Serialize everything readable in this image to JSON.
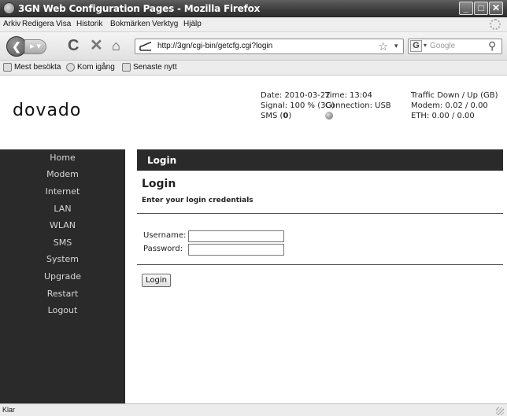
{
  "window": {
    "title": "3GN Web Configuration Pages - Mozilla Firefox",
    "min_glyph": "_",
    "max_glyph": "□",
    "close_glyph": "✕"
  },
  "menubar": {
    "items": [
      "Arkiv",
      "Redigera",
      "Visa",
      "Historik",
      "Bokmärken",
      "Verktyg",
      "Hjälp"
    ]
  },
  "toolbar": {
    "back_glyph": "❮",
    "forward_glyph": "▸ ▾",
    "reload_glyph": "C",
    "stop_glyph": "✕",
    "home_glyph": "⌂",
    "url": "http://3gn/cgi-bin/getcfg.cgi?login",
    "star_glyph": "☆",
    "dropdown_glyph": "▾",
    "search_placeholder": "Google",
    "search_engine_glyph": "G",
    "search_icon_glyph": "⚲"
  },
  "bookmarks": {
    "items": [
      "Mest besökta",
      "Kom igång",
      "Senaste nytt"
    ]
  },
  "header": {
    "logo_text": "dovado",
    "date": "Date: 2010-03-22",
    "signal": "Signal: 100 % (3G)",
    "sms_label": "SMS (",
    "sms_count": "0",
    "sms_close": ")",
    "time": "Time: 13:04",
    "connection": "Connection: USB",
    "traffic_title": "Traffic Down / Up (GB)",
    "modem": "Modem: 0.02 / 0.00",
    "eth": "ETH: 0.00 / 0.00"
  },
  "sidebar": {
    "items": [
      "Home",
      "Modem",
      "Internet",
      "LAN",
      "WLAN",
      "SMS",
      "System",
      "Upgrade",
      "Restart",
      "Logout"
    ]
  },
  "login": {
    "banner": "Login",
    "heading": "Login",
    "subheading": "Enter your login credentials",
    "username_label": "Username:",
    "password_label": "Password:",
    "username_value": "",
    "password_value": "",
    "button_label": "Login"
  },
  "status": {
    "text": "Klar"
  },
  "colors": {
    "nav_background": "#2a2a2a",
    "nav_text": "#d6d6d6"
  }
}
